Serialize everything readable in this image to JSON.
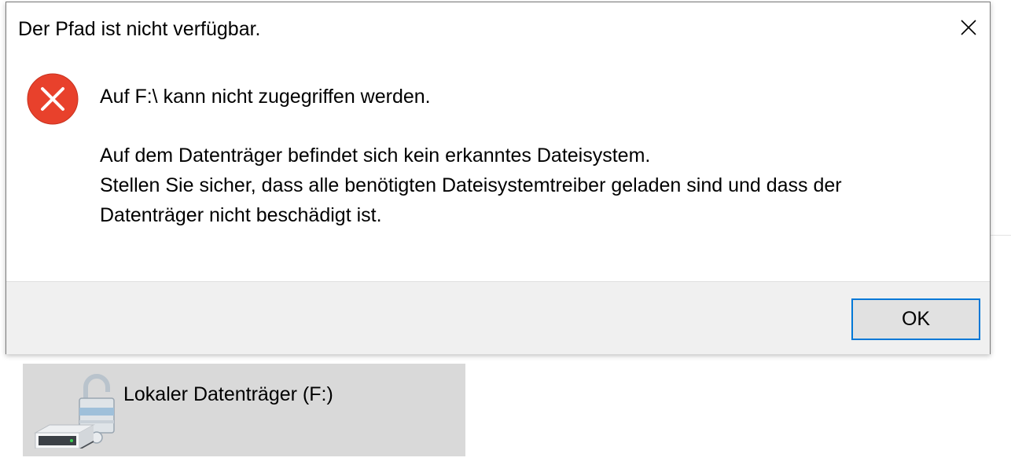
{
  "dialog": {
    "title": "Der Pfad ist nicht verfügbar.",
    "heading": "Auf F:\\ kann nicht zugegriffen werden.",
    "body_lines": [
      "Auf dem Datenträger befindet sich kein erkanntes Dateisystem.",
      "Stellen Sie sicher, dass alle benötigten Dateisystemtreiber geladen sind und dass der",
      "Datenträger nicht beschädigt ist."
    ],
    "ok_label": "OK",
    "icons": {
      "close": "close-icon",
      "error": "error-icon"
    },
    "colors": {
      "error_red": "#e8412c",
      "accent_blue": "#0078d7"
    }
  },
  "explorer": {
    "drive": {
      "label": "Lokaler Datenträger (F:)",
      "icon": "locked-drive-icon"
    }
  }
}
